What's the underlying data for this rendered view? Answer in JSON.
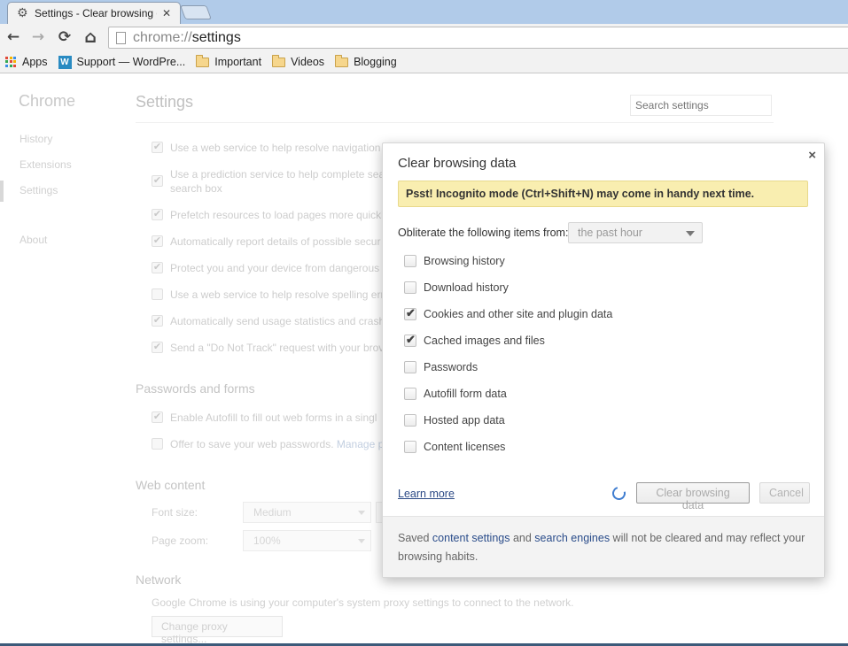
{
  "browser": {
    "tab": {
      "title": "Settings - Clear browsing data",
      "icon": "gear-icon",
      "close": "✕"
    },
    "nav": {
      "back": "←",
      "forward": "→",
      "reload": "⟳",
      "home": "⌂"
    },
    "omnibox": {
      "scheme": "chrome://",
      "path": "settings"
    },
    "bookmarks": [
      {
        "label": "Apps",
        "icon": "apps-grid-icon"
      },
      {
        "label": "Support — WordPre...",
        "icon": "wordpress-icon"
      },
      {
        "label": "Important",
        "icon": "folder-icon"
      },
      {
        "label": "Videos",
        "icon": "folder-icon"
      },
      {
        "label": "Blogging",
        "icon": "folder-icon"
      }
    ]
  },
  "settings_page": {
    "sidebar": {
      "title": "Chrome",
      "items": [
        {
          "label": "History"
        },
        {
          "label": "Extensions"
        },
        {
          "label": "Settings",
          "active": true
        },
        {
          "label": "About"
        }
      ]
    },
    "title": "Settings",
    "search_placeholder": "Search settings",
    "privacy_options": [
      {
        "label": "Use a web service to help resolve navigation e",
        "checked": true
      },
      {
        "label": "Use a prediction service to help complete sea",
        "label2": "search box",
        "checked": true
      },
      {
        "label": "Prefetch resources to load pages more quickl",
        "checked": true
      },
      {
        "label": "Automatically report details of possible secur",
        "checked": true
      },
      {
        "label": "Protect you and your device from dangerous",
        "checked": true
      },
      {
        "label": "Use a web service to help resolve spelling err",
        "checked": false
      },
      {
        "label": "Automatically send usage statistics and crash",
        "checked": true
      },
      {
        "label": "Send a \"Do Not Track\" request with your brov",
        "checked": true
      }
    ],
    "passwords_section": {
      "title": "Passwords and forms",
      "options": [
        {
          "label": "Enable Autofill to fill out web forms in a singl",
          "checked": true
        },
        {
          "label": "Offer to save your web passwords.",
          "link": "Manage p",
          "checked": false
        }
      ]
    },
    "web_content": {
      "title": "Web content",
      "font_size_label": "Font size:",
      "font_size_value": "Medium",
      "page_zoom_label": "Page zoom:",
      "page_zoom_value": "100%"
    },
    "network": {
      "title": "Network",
      "text": "Google Chrome is using your computer's system proxy settings to connect to the network.",
      "button": "Change proxy settings..."
    }
  },
  "dialog": {
    "title": "Clear browsing data",
    "close": "×",
    "banner": "Psst! Incognito mode (Ctrl+Shift+N) may come in handy next time.",
    "from_label": "Obliterate the following items from:",
    "from_value": "the past hour",
    "items": [
      {
        "label": "Browsing history",
        "checked": false
      },
      {
        "label": "Download history",
        "checked": false
      },
      {
        "label": "Cookies and other site and plugin data",
        "checked": true
      },
      {
        "label": "Cached images and files",
        "checked": true
      },
      {
        "label": "Passwords",
        "checked": false
      },
      {
        "label": "Autofill form data",
        "checked": false
      },
      {
        "label": "Hosted app data",
        "checked": false
      },
      {
        "label": "Content licenses",
        "checked": false
      }
    ],
    "learn_more": "Learn more",
    "clear_button": "Clear browsing data",
    "cancel_button": "Cancel",
    "footer": {
      "pre": "Saved ",
      "link1": "content settings",
      "mid": " and ",
      "link2": "search engines",
      "post": " will not be cleared and may reflect your browsing habits."
    },
    "colors": {
      "banner_bg": "#f9eeb0",
      "link": "#2c4a86",
      "spinner": "#3f7dd0"
    }
  }
}
